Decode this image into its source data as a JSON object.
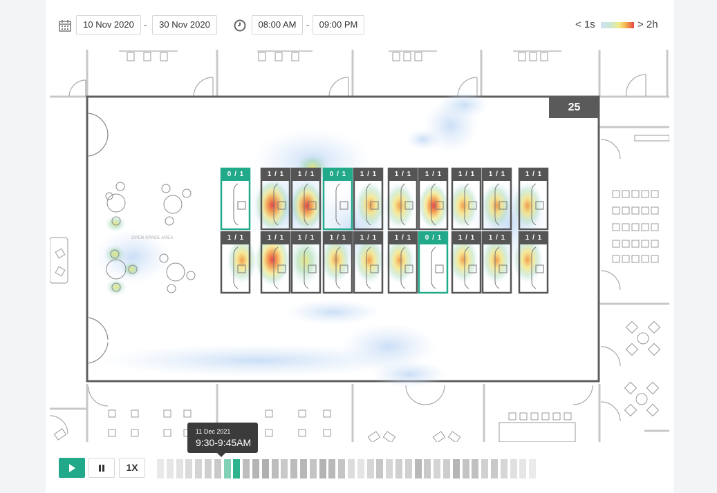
{
  "filters": {
    "date_from": "10 Nov 2020",
    "date_to": "30 Nov 2020",
    "time_from": "08:00 AM",
    "time_to": "09:00 PM",
    "separator": "-",
    "calendar_icon": "calendar-icon",
    "clock_icon": "clock-icon"
  },
  "legend": {
    "min_label": "< 1s",
    "max_label": "> 2h",
    "colors": [
      "#cfe0f5",
      "#c9e7d2",
      "#f2eb8a",
      "#f3b34d",
      "#e84545"
    ]
  },
  "zone": {
    "count": "25",
    "open_space_label": "OPEN SPACE AREA"
  },
  "desks": {
    "top": [
      "0 / 1",
      "1 / 1",
      "1 / 1",
      "0 / 1",
      "1 / 1",
      "1 / 1",
      "1 / 1",
      "1 / 1",
      "1 / 1",
      "1 / 1"
    ],
    "bottom": [
      "1 / 1",
      "1 / 1",
      "1 / 1",
      "1 / 1",
      "1 / 1",
      "1 / 1",
      "0 / 1",
      "1 / 1",
      "1 / 1",
      "1 / 1"
    ]
  },
  "status_colors": {
    "occupied": "#555555",
    "free": "#22a98a"
  },
  "playback": {
    "play_icon": "play-icon",
    "pause_icon": "pause-icon",
    "speed_label": "1X",
    "tooltip_date": "11 Dec 2021",
    "tooltip_time": "9:30-9:45AM",
    "selected_slot_index": 7,
    "slot_count": 40
  }
}
